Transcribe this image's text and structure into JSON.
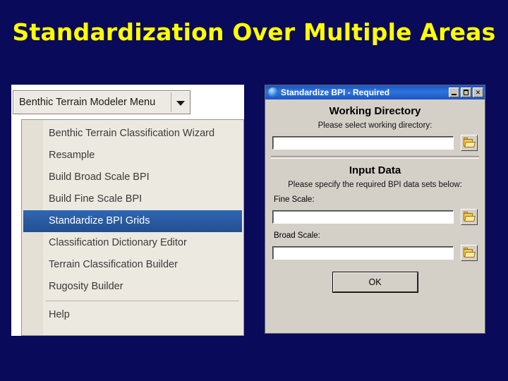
{
  "slide": {
    "title": "Standardization Over Multiple Areas",
    "background_color": "#0a0a5a",
    "title_color": "#ffff00"
  },
  "menu_screenshot": {
    "dropdown_button": {
      "label": "Benthic Terrain Modeler Menu",
      "arrow_icon": "chevron-down-icon"
    },
    "items": [
      {
        "label": "Benthic Terrain Classification Wizard",
        "selected": false,
        "separator_after": false
      },
      {
        "label": "Resample",
        "selected": false,
        "separator_after": false
      },
      {
        "label": "Build Broad Scale BPI",
        "selected": false,
        "separator_after": false
      },
      {
        "label": "Build Fine Scale BPI",
        "selected": false,
        "separator_after": false
      },
      {
        "label": "Standardize BPI Grids",
        "selected": true,
        "separator_after": false
      },
      {
        "label": "Classification Dictionary Editor",
        "selected": false,
        "separator_after": false
      },
      {
        "label": "Terrain Classification Builder",
        "selected": false,
        "separator_after": false
      },
      {
        "label": "Rugosity Builder",
        "selected": false,
        "separator_after": true
      },
      {
        "label": "Help",
        "selected": false,
        "separator_after": false
      }
    ]
  },
  "dialog": {
    "titlebar": {
      "icon": "application-globe-icon",
      "title": "Standardize BPI - Required",
      "minimize_label": "_",
      "maximize_label": "□",
      "close_label": "✕"
    },
    "working_directory": {
      "heading": "Working Directory",
      "instruction": "Please select working directory:",
      "input_value": "",
      "input_placeholder": "",
      "browse_icon": "folder-open-icon"
    },
    "input_data": {
      "heading": "Input Data",
      "instruction": "Please specify the required BPI data sets below:",
      "fields": [
        {
          "label": "Fine Scale:",
          "value": "",
          "browse_icon": "folder-open-icon"
        },
        {
          "label": "Broad Scale:",
          "value": "",
          "browse_icon": "folder-open-icon"
        }
      ]
    },
    "ok_label": "OK"
  }
}
